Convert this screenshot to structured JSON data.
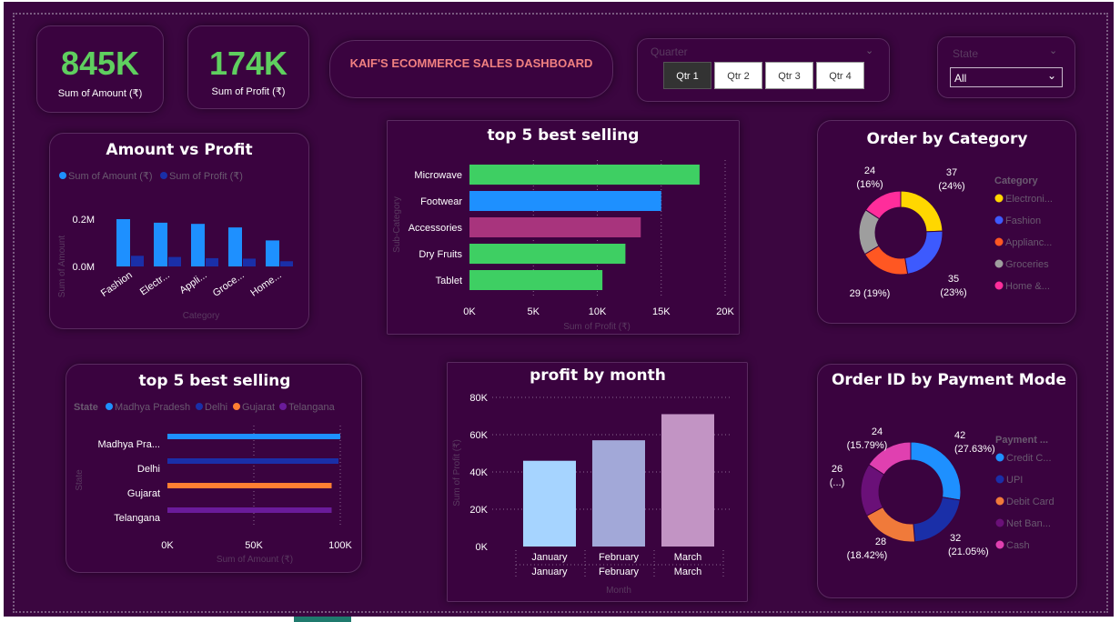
{
  "kpis": [
    {
      "value": "845K",
      "label": "Sum of Amount (₹)"
    },
    {
      "value": "174K",
      "label": "Sum of Profit (₹)"
    }
  ],
  "dashboard_title": "KAIF'S ECOMMERCE SALES DASHBOARD",
  "quarter_slicer": {
    "label": "Quarter",
    "options": [
      "Qtr 1",
      "Qtr 2",
      "Qtr 3",
      "Qtr 4"
    ],
    "selected": "Qtr 1"
  },
  "state_slicer": {
    "label": "State",
    "value": "All"
  },
  "colors": {
    "green": "#3ecf63",
    "blue": "#1e90ff",
    "magenta": "#a8347d",
    "background": "#3b0640"
  },
  "chart_data": [
    {
      "type": "bar",
      "title": "Amount vs Profit",
      "categories": [
        "Fashion",
        "Electr...",
        "Appli...",
        "Groce...",
        "Home..."
      ],
      "series": [
        {
          "name": "Sum of Amount (₹)",
          "values": [
            0.2,
            0.185,
            0.18,
            0.165,
            0.11
          ]
        },
        {
          "name": "Sum of Profit (₹)",
          "values": [
            0.045,
            0.04,
            0.035,
            0.033,
            0.022
          ]
        }
      ],
      "yticks": [
        "0.0M",
        "0.2M"
      ],
      "ylim": [
        0,
        0.2
      ],
      "xlabel": "Category",
      "ylabel": "Sum of Amount",
      "legend": "top"
    },
    {
      "type": "bar",
      "orientation": "horizontal",
      "title": "top 5 best selling",
      "categories": [
        "Microwave",
        "Footwear",
        "Accessories",
        "Dry Fruits",
        "Tablet"
      ],
      "values": [
        18000,
        15000,
        13400,
        12200,
        10400
      ],
      "bar_colors": [
        "#3ecf63",
        "#1e90ff",
        "#a8347d",
        "#3ecf63",
        "#3ecf63"
      ],
      "xticks": [
        "0K",
        "5K",
        "10K",
        "15K",
        "20K"
      ],
      "xlim": [
        0,
        20000
      ],
      "xlabel": "Sum of Profit (₹)",
      "ylabel": "Sub-Category"
    },
    {
      "type": "pie",
      "title": "Order by Category",
      "legend_title": "Category",
      "slices": [
        {
          "name": "Electroni...",
          "value": 37,
          "label_value": "37",
          "label_pct": "(24%)",
          "color": "#ffd700"
        },
        {
          "name": "Fashion",
          "value": 35,
          "label_value": "35",
          "label_pct": "(23%)",
          "color": "#3d5afe"
        },
        {
          "name": "Applianc...",
          "value": 29,
          "label_value": "29 (19%)",
          "label_pct": "",
          "color": "#ff5722"
        },
        {
          "name": "Groceries",
          "value": 27,
          "label_value": "",
          "label_pct": "",
          "color": "#9e9e9e"
        },
        {
          "name": "Home &...",
          "value": 24,
          "label_value": "24",
          "label_pct": "(16%)",
          "color": "#ff2d9b"
        }
      ]
    },
    {
      "type": "bar",
      "orientation": "horizontal",
      "title": "top 5 best selling",
      "legend_title": "State",
      "categories": [
        "Madhya Pra...",
        "Delhi",
        "Gujarat",
        "Telangana"
      ],
      "series_names": [
        "Madhya Pradesh",
        "Delhi",
        "Gujarat",
        "Telangana"
      ],
      "values": [
        100000,
        99000,
        95000,
        95000
      ],
      "bar_colors": [
        "#1e90ff",
        "#1a2fa8",
        "#ff7f32",
        "#6a1b9a"
      ],
      "xticks": [
        "0K",
        "50K",
        "100K"
      ],
      "xlim": [
        0,
        100000
      ],
      "xlabel": "Sum of Amount (₹)",
      "ylabel": "State",
      "legend": "top"
    },
    {
      "type": "bar",
      "title": "profit by month",
      "categories": [
        "January",
        "February",
        "March"
      ],
      "values": [
        46000,
        57000,
        71000
      ],
      "bar_colors": [
        "#a6d4ff",
        "#a2a8d8",
        "#c294c4"
      ],
      "yticks": [
        "0K",
        "20K",
        "40K",
        "60K",
        "80K"
      ],
      "ylim": [
        0,
        80000
      ],
      "xlabel": "Month",
      "ylabel": "Sum of Profit (₹)"
    },
    {
      "type": "pie",
      "title": "Order ID by Payment Mode",
      "legend_title": "Payment ...",
      "slices": [
        {
          "name": "Credit C...",
          "value": 42,
          "label_value": "42",
          "label_pct": "(27.63%)",
          "color": "#1e90ff"
        },
        {
          "name": "UPI",
          "value": 32,
          "label_value": "32",
          "label_pct": "(21.05%)",
          "color": "#1a2fa8"
        },
        {
          "name": "Debit Card",
          "value": 28,
          "label_value": "28",
          "label_pct": "(18.42%)",
          "color": "#f07a3a"
        },
        {
          "name": "Net Ban...",
          "value": 26,
          "label_value": "26",
          "label_pct": "(...)",
          "color": "#6a1078"
        },
        {
          "name": "Cash",
          "value": 24,
          "label_value": "24",
          "label_pct": "(15.79%)",
          "color": "#e040b0"
        }
      ]
    }
  ]
}
